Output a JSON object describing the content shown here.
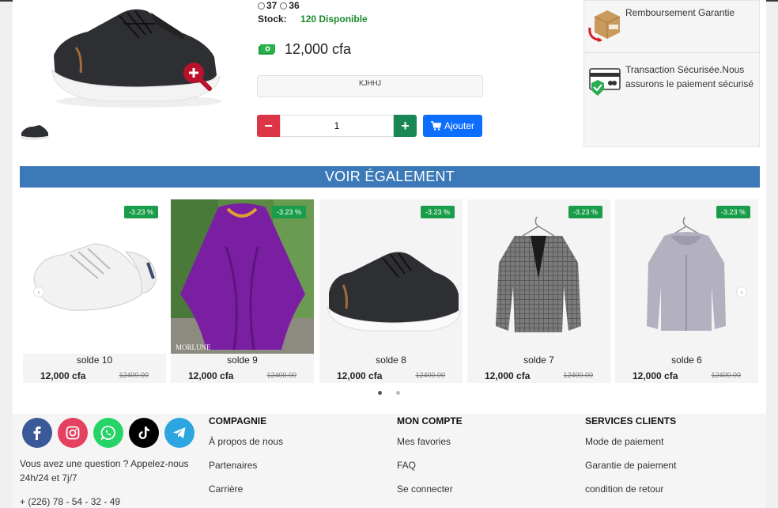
{
  "product": {
    "sizes": [
      "37",
      "36"
    ],
    "stock_label": "Stock:",
    "stock_value": "120 Disponible",
    "price": "12,000 cfa",
    "code": "KJHHJ",
    "quantity": "1",
    "add_label": "Ajouter"
  },
  "guarantee": {
    "items": [
      {
        "icon": "return-box-icon",
        "text": "Remboursement Garantie"
      },
      {
        "icon": "secure-card-icon",
        "text": "Transaction Sécurisée.Nous assurons le paiement sécurisé"
      }
    ]
  },
  "related": {
    "title": "VOIR ÉGALEMENT",
    "cards": [
      {
        "name": "solde 10",
        "price": "12,000 cfa",
        "old_price": "12400.00",
        "discount": "-3.23 %",
        "image": "white-sneaker"
      },
      {
        "name": "solde 9",
        "price": "12,000 cfa",
        "old_price": "12400.00",
        "discount": "-3.23 %",
        "image": "purple-dress",
        "watermark": "MORLUNE"
      },
      {
        "name": "solde 8",
        "price": "12,000 cfa",
        "old_price": "12400.00",
        "discount": "-3.23 %",
        "image": "black-sneaker"
      },
      {
        "name": "solde 7",
        "price": "12,000 cfa",
        "old_price": "12400.00",
        "discount": "-3.23 %",
        "image": "grey-blazer"
      },
      {
        "name": "solde 6",
        "price": "12,000 cfa",
        "old_price": "12400.00",
        "discount": "-3.23 %",
        "image": "grey-hoodie"
      }
    ]
  },
  "footer": {
    "socials": [
      {
        "name": "facebook-icon",
        "color": "#3b5998"
      },
      {
        "name": "instagram-icon",
        "color": "#e4405f"
      },
      {
        "name": "whatsapp-icon",
        "color": "#25d366"
      },
      {
        "name": "tiktok-icon",
        "color": "#000000"
      },
      {
        "name": "telegram-icon",
        "color": "#2ca5e0"
      }
    ],
    "help_text": "Vous avez une question ? Appelez-nous 24h/24 et 7j/7",
    "phone": "+ (226) 78 - 54 - 32 - 49",
    "columns": [
      {
        "title": "COMPAGNIE",
        "links": [
          "À propos de nous",
          "Partenaires",
          "Carrière"
        ]
      },
      {
        "title": "MON COMPTE",
        "links": [
          "Mes favories",
          "FAQ",
          "Se connecter"
        ]
      },
      {
        "title": "SERVICES CLIENTS",
        "links": [
          "Mode de paiement",
          "Garantie de paiement",
          "condition de retour"
        ]
      }
    ]
  },
  "colors": {
    "primary": "#0d6efd",
    "danger": "#dc3545",
    "success": "#198754",
    "banner": "#3b79b8",
    "badge": "#1a9d4a"
  }
}
